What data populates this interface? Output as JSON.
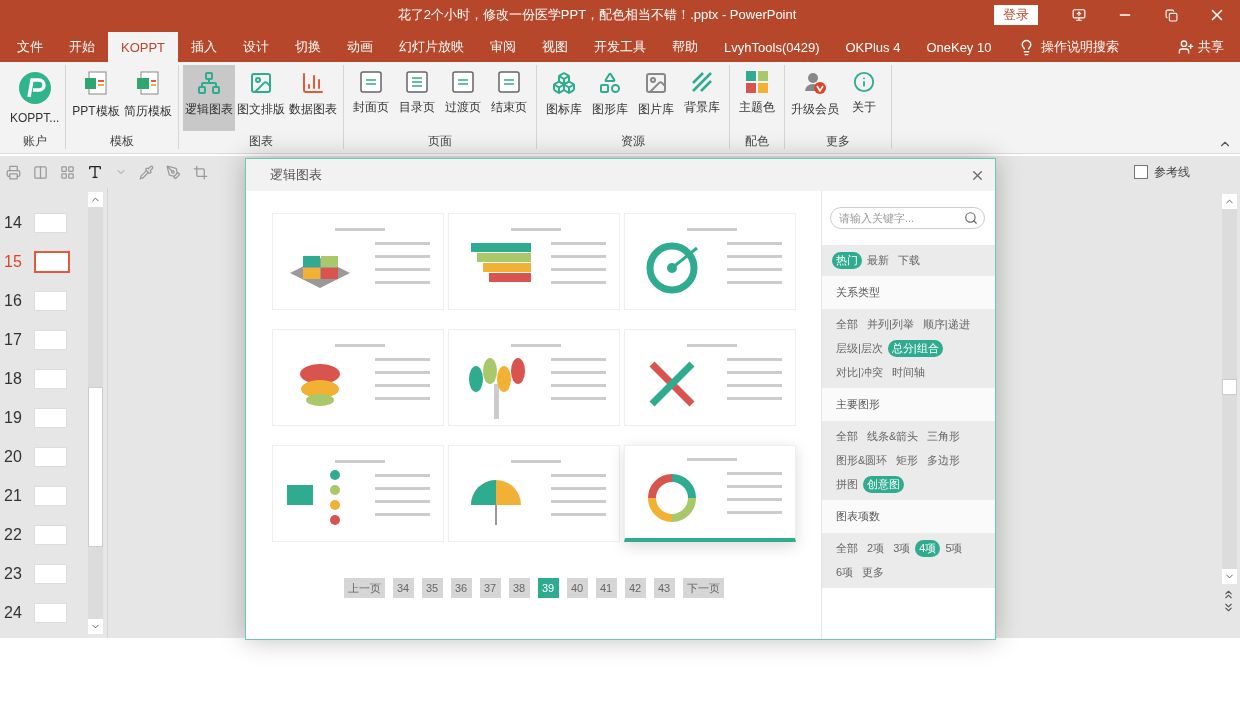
{
  "window": {
    "title": "花了2个小时，修改一份医学PPT，配色相当不错！.pptx  -  PowerPoint",
    "login": "登录"
  },
  "tabs": [
    {
      "label": "文件",
      "selected": false
    },
    {
      "label": "开始",
      "selected": false
    },
    {
      "label": "KOPPT",
      "selected": true
    },
    {
      "label": "插入",
      "selected": false
    },
    {
      "label": "设计",
      "selected": false
    },
    {
      "label": "切换",
      "selected": false
    },
    {
      "label": "动画",
      "selected": false
    },
    {
      "label": "幻灯片放映",
      "selected": false
    },
    {
      "label": "审阅",
      "selected": false
    },
    {
      "label": "视图",
      "selected": false
    },
    {
      "label": "开发工具",
      "selected": false
    },
    {
      "label": "帮助",
      "selected": false
    },
    {
      "label": "LvyhTools(0429)",
      "selected": false
    },
    {
      "label": "OKPlus 4",
      "selected": false
    },
    {
      "label": "OneKey 10",
      "selected": false
    }
  ],
  "tell_me": "操作说明搜索",
  "share": "共享",
  "ribbon": [
    {
      "label": "账户",
      "buttons": [
        {
          "label": "KOPPT...",
          "kind": "logo",
          "selected": false
        }
      ]
    },
    {
      "label": "模板",
      "buttons": [
        {
          "label": "PPT模板",
          "kind": "ppt",
          "selected": false
        },
        {
          "label": "简历模板",
          "kind": "cv",
          "selected": false
        }
      ]
    },
    {
      "label": "图表",
      "buttons": [
        {
          "label": "逻辑图表",
          "kind": "logic",
          "selected": true
        },
        {
          "label": "图文排版",
          "kind": "layout",
          "selected": false
        },
        {
          "label": "数据图表",
          "kind": "data",
          "selected": false
        }
      ]
    },
    {
      "label": "页面",
      "buttons": [
        {
          "label": "封面页",
          "kind": "cover",
          "selected": false
        },
        {
          "label": "目录页",
          "kind": "toc",
          "selected": false
        },
        {
          "label": "过渡页",
          "kind": "transition",
          "selected": false
        },
        {
          "label": "结束页",
          "kind": "end",
          "selected": false
        }
      ]
    },
    {
      "label": "资源",
      "buttons": [
        {
          "label": "图标库",
          "kind": "icons",
          "selected": false
        },
        {
          "label": "图形库",
          "kind": "shapes",
          "selected": false
        },
        {
          "label": "图片库",
          "kind": "pictures",
          "selected": false
        },
        {
          "label": "背景库",
          "kind": "backgrounds",
          "selected": false
        }
      ]
    },
    {
      "label": "配色",
      "buttons": [
        {
          "label": "主题色",
          "kind": "theme",
          "selected": false
        }
      ]
    },
    {
      "label": "更多",
      "buttons": [
        {
          "label": "升级会员",
          "kind": "vip",
          "selected": false
        },
        {
          "label": "关于",
          "kind": "about",
          "selected": false
        }
      ]
    }
  ],
  "toolbar": {
    "guides": {
      "label": "参考线",
      "checked": false
    }
  },
  "slides": [
    {
      "number": "14",
      "selected": false
    },
    {
      "number": "15",
      "selected": true
    },
    {
      "number": "16",
      "selected": false
    },
    {
      "number": "17",
      "selected": false
    },
    {
      "number": "18",
      "selected": false
    },
    {
      "number": "19",
      "selected": false
    },
    {
      "number": "20",
      "selected": false
    },
    {
      "number": "21",
      "selected": false
    },
    {
      "number": "22",
      "selected": false
    },
    {
      "number": "23",
      "selected": false
    },
    {
      "number": "24",
      "selected": false
    }
  ],
  "dialog": {
    "title": "逻辑图表",
    "templates": [
      {
        "kind": "blocks",
        "selected": false
      },
      {
        "kind": "pyramid",
        "selected": false
      },
      {
        "kind": "target",
        "selected": false
      },
      {
        "kind": "apple",
        "selected": false
      },
      {
        "kind": "tree",
        "selected": false
      },
      {
        "kind": "cross",
        "selected": false
      },
      {
        "kind": "monitor",
        "selected": false
      },
      {
        "kind": "umbrella",
        "selected": false
      },
      {
        "kind": "cycle",
        "selected": true
      }
    ],
    "pagination": {
      "prev": "上一页",
      "next": "下一页",
      "pages": [
        {
          "label": "34",
          "selected": false
        },
        {
          "label": "35",
          "selected": false
        },
        {
          "label": "36",
          "selected": false
        },
        {
          "label": "37",
          "selected": false
        },
        {
          "label": "38",
          "selected": false
        },
        {
          "label": "39",
          "selected": true
        },
        {
          "label": "40",
          "selected": false
        },
        {
          "label": "41",
          "selected": false
        },
        {
          "label": "42",
          "selected": false
        },
        {
          "label": "43",
          "selected": false
        }
      ]
    },
    "search": {
      "placeholder": "请输入关键字..."
    },
    "sort": [
      {
        "label": "热门",
        "selected": true
      },
      {
        "label": "最新",
        "selected": false
      },
      {
        "label": "下载",
        "selected": false
      }
    ],
    "filters": [
      {
        "title": "关系类型",
        "options": [
          {
            "label": "全部",
            "selected": false
          },
          {
            "label": "并列|列举",
            "selected": false
          },
          {
            "label": "顺序|递进",
            "selected": false
          },
          {
            "label": "层级|层次",
            "selected": false
          },
          {
            "label": "总分|组合",
            "selected": true
          },
          {
            "label": "对比|冲突",
            "selected": false
          },
          {
            "label": "时间轴",
            "selected": false
          }
        ]
      },
      {
        "title": "主要图形",
        "options": [
          {
            "label": "全部",
            "selected": false
          },
          {
            "label": "线条&箭头",
            "selected": false
          },
          {
            "label": "三角形",
            "selected": false
          },
          {
            "label": "图形&圆环",
            "selected": false
          },
          {
            "label": "矩形",
            "selected": false
          },
          {
            "label": "多边形",
            "selected": false
          },
          {
            "label": "拼图",
            "selected": false
          },
          {
            "label": "创意图",
            "selected": true
          }
        ]
      },
      {
        "title": "图表项数",
        "options": [
          {
            "label": "全部",
            "selected": false
          },
          {
            "label": "2项",
            "selected": false
          },
          {
            "label": "3项",
            "selected": false
          },
          {
            "label": "4项",
            "selected": true
          },
          {
            "label": "5项",
            "selected": false
          },
          {
            "label": "6项",
            "selected": false
          },
          {
            "label": "更多",
            "selected": false
          }
        ]
      }
    ]
  }
}
